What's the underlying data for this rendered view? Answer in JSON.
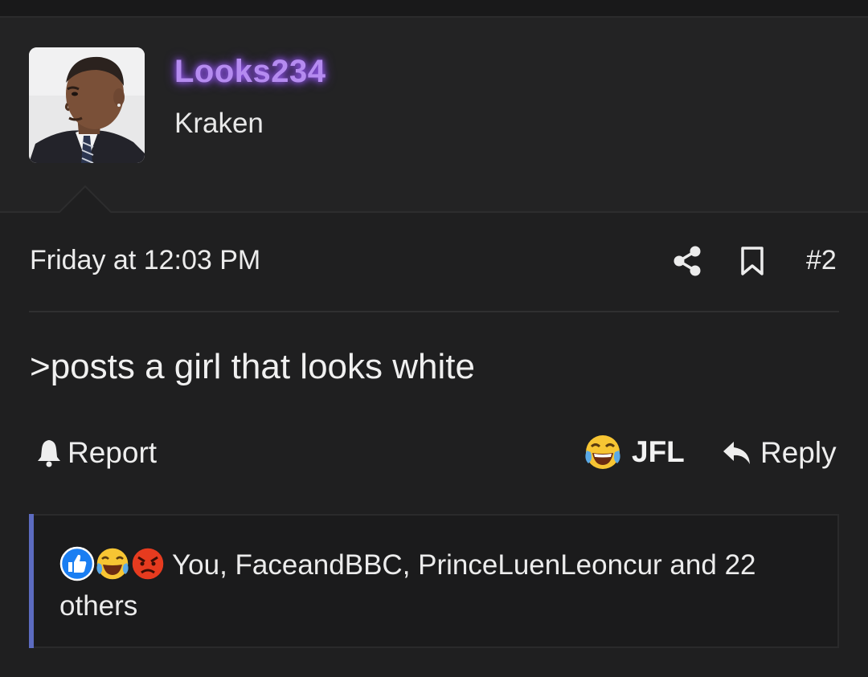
{
  "post": {
    "username": "Looks234",
    "user_title": "Kraken",
    "date": "Friday at 12:03 PM",
    "post_number": "#2",
    "content": ">posts a girl that looks white",
    "actions": {
      "report_label": "Report",
      "reaction_label": "JFL",
      "reply_label": "Reply"
    },
    "reactions": {
      "icons": [
        "like-icon",
        "laughing-crying-icon",
        "angry-icon"
      ],
      "users": [
        "You",
        "FaceandBBC",
        "PrinceLuenLeoncur"
      ],
      "sep1": ", ",
      "sep2": ", ",
      "tail": " and ",
      "others_label": "22 others"
    }
  },
  "colors": {
    "background": "#1f1f20",
    "header_bg": "#232324",
    "username": "#b58bf0",
    "reaction_bar": "#5c6bc0",
    "text": "#ececec"
  }
}
